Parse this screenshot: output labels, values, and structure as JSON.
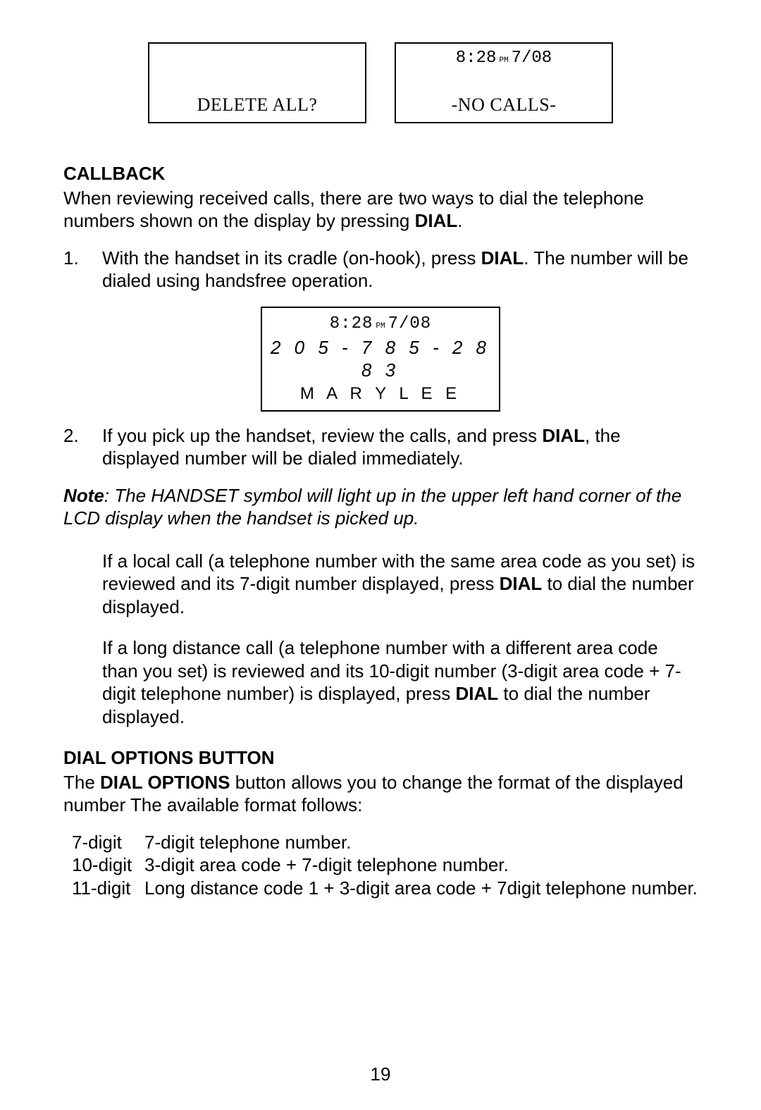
{
  "lcd_top_left": {
    "bottom": "DELETE ALL?"
  },
  "lcd_top_right": {
    "time_a": "8:28",
    "pm": "PM",
    "time_b": "7/08",
    "bottom": "-NO CALLS-"
  },
  "callback_heading": "CALLBACK",
  "callback_intro_a": "When reviewing received calls, there are two ways to dial the telephone numbers shown on the display by pressing ",
  "callback_intro_b": "DIAL",
  "callback_intro_c": ".",
  "step1_num": "1.",
  "step1_a": "With the handset in its cradle (on-hook), press ",
  "step1_b": "DIAL",
  "step1_c": ". The number will be dialed using handsfree operation.",
  "lcd_mid": {
    "time_a": "8:28",
    "pm": "PM",
    "time_b": "7/08",
    "number": "2 0 5 - 7 8 5 - 2 8 8 3",
    "name": "M A R Y   L E E"
  },
  "step2_num": "2.",
  "step2_a": "If you pick up the handset, review the calls, and press ",
  "step2_b": "DIAL",
  "step2_c": ", the displayed number will be dialed immediately.",
  "note_lead": "Note",
  "note_body": ": The HANDSET symbol will light up in the upper left hand corner of the LCD display when the handset is picked up.",
  "local_a": "If a local call (a telephone number with the same area code as you set) is reviewed and its 7-digit number displayed, press ",
  "local_b": "DIAL",
  "local_c": " to dial the number displayed.",
  "long_a": "If a long distance call (a telephone number with a different area code than you set) is reviewed and its 10-digit number (3-digit area code + 7-digit telephone number) is displayed, press ",
  "long_b": "DIAL",
  "long_c": " to dial the number displayed.",
  "dial_heading": "DIAL OPTIONS BUTTON",
  "dial_intro_a": "The ",
  "dial_intro_b": "DIAL OPTIONS",
  "dial_intro_c": " button allows you to change the format of the displayed number The available format follows:",
  "formats": [
    {
      "label": "7-digit",
      "desc": "7-digit telephone number."
    },
    {
      "label": "10-digit",
      "desc": "3-digit area code + 7-digit telephone number."
    },
    {
      "label": "11-digit",
      "desc": "Long distance code 1 + 3-digit area code + 7digit telephone number."
    }
  ],
  "page_number": "19"
}
